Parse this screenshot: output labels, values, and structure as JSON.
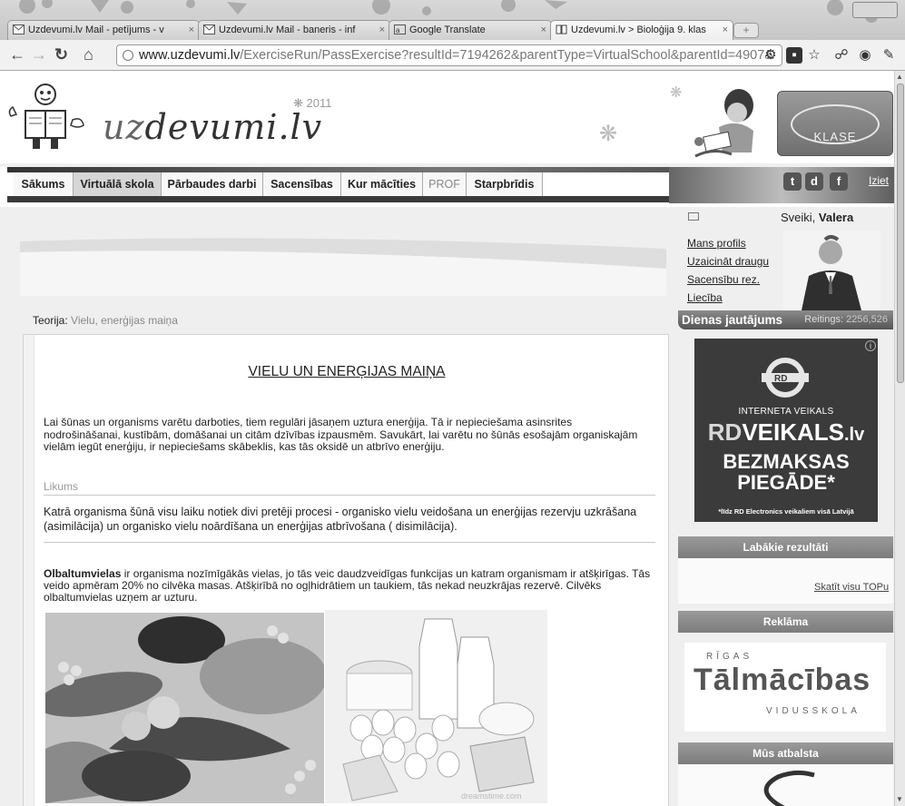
{
  "browser": {
    "tabs": [
      {
        "label": "Uzdevumi.lv Mail - petījums - v",
        "icon": "gmail-icon"
      },
      {
        "label": "Uzdevumi.lv Mail - baneris - inf",
        "icon": "gmail-icon"
      },
      {
        "label": "Google Translate",
        "icon": "translate-icon"
      },
      {
        "label": "Uzdevumi.lv > Bioloģija 9. klas",
        "icon": "book-icon"
      }
    ],
    "url_host": "www.uzdevumi.lv",
    "url_path": "/ExerciseRun/PassExercise?resultId=7194262&parentType=VirtualSchool&parentId=4907&"
  },
  "header": {
    "logo_uz": "uz",
    "logo_rest": "devumi.lv",
    "year": "2011",
    "klase_label": "KLASE"
  },
  "menu": {
    "items": [
      "Sākums",
      "Virtuālā skola",
      "Pārbaudes darbi",
      "Sacensības",
      "Kur mācīties",
      "PROF",
      "Starpbrīdis"
    ],
    "logout": "Iziet"
  },
  "user": {
    "greeting": "Sveiki, ",
    "name": "Valera",
    "links": [
      "Mans profils",
      "Uzaicināt draugu",
      "Sacensību rez.",
      "Liecība"
    ],
    "daily_label": "Dienas jautājums",
    "rating_label": "Reitings:",
    "rating_value": "2256,526"
  },
  "ads": {
    "rd": {
      "line1": "INTERNETA VEIKALS",
      "brand_rd": "RD",
      "brand_rest": "VEIKALS",
      "brand_tld": ".lv",
      "line3a": "BEZMAKSAS",
      "line3b": "PIEGĀDE*",
      "footnote": "*līdz RD Electronics veikaliem visā Latvijā"
    },
    "talmacibas": {
      "name": "Tālmācības",
      "arc_top": "RĪGAS",
      "arc_bottom": "VIDUSSKOLA"
    }
  },
  "sidebar": {
    "best_results_title": "Labākie rezultāti",
    "all_top_link": "Skatīt visu TOPu",
    "ads_title": "Reklāma",
    "support_title": "Mūs atbalsta"
  },
  "content": {
    "theory_label": "Teorija:",
    "theory_topic": "Vielu, enerģijas maiņa",
    "title": "VIELU UN ENERĢIJAS MAIŅA",
    "paragraph1": "Lai šūnas un organisms varētu darboties, tiem regulāri jāsaņem uztura enerģija. Tā ir nepieciešama asinsrites nodrošināšanai, kustībām, domāšanai un citām dzīvības izpausmēm. Savukārt, lai varētu no šūnās esošajām organiskajām vielām iegūt enerģiju, ir nepieciešams skābeklis, kas tās oksidē un atbrīvo enerģiju.",
    "law_label": "Likums",
    "paragraph2": "Katrā organisma šūnā visu laiku notiek divi pretēji procesi -  organisko vielu veidošana un enerģijas rezervju uzkrāšana (asimilācija) un organisko vielu noārdīšana un enerģijas atbrīvošana ( disimilācija).",
    "paragraph3_bold": "Olbaltumvielas",
    "paragraph3": " ir organisma nozīmīgākās vielas, jo tās veic daudzveidīgas funkcijas un katram organismam ir atšķirīgas. Tās veido apmēram 20% no cilvēka masas. Atšķirībā no ogļhidrātiem un taukiem, tās nekad neuzkrājas rezervē. Cilvēks olbaltumvielas uzņem ar uzturu.",
    "watermark": "dreamstime.com"
  }
}
